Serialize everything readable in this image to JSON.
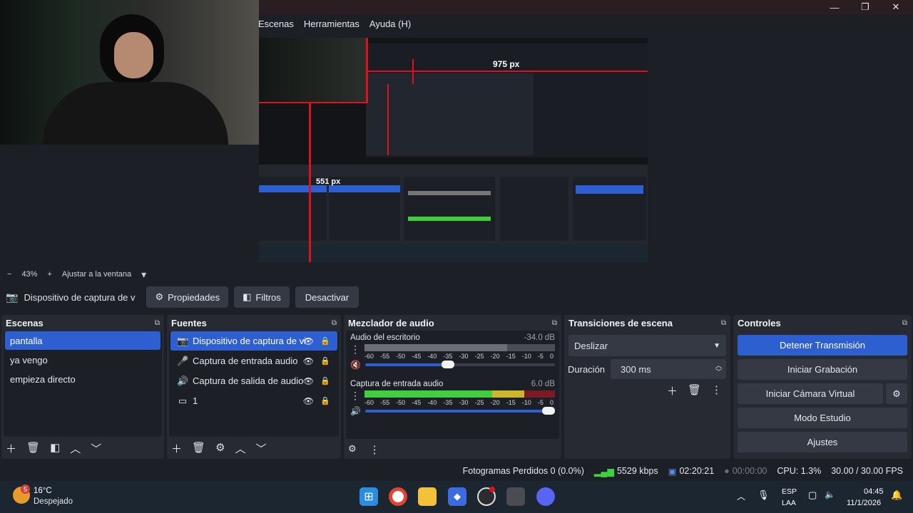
{
  "window": {
    "minimize": "—",
    "maximize": "❐",
    "close": "✕"
  },
  "menu": {
    "items": [
      "Escenas",
      "Herramientas",
      "Ayuda (H)"
    ]
  },
  "preview": {
    "annotation_width": "975 px",
    "annotation_height": "551 px"
  },
  "zoom": {
    "minus": "−",
    "percent": "43%",
    "plus": "+",
    "fit_label": "Ajustar a la ventana",
    "dropdown": "▾"
  },
  "context": {
    "source_name": "Dispositivo de captura de v",
    "properties": "Propiedades",
    "filters": "Filtros",
    "deactivate": "Desactivar"
  },
  "scenes": {
    "title": "Escenas",
    "items": [
      "pantalla",
      "ya vengo",
      "empieza directo"
    ],
    "selected_index": 0
  },
  "sources": {
    "title": "Fuentes",
    "items": [
      {
        "label": "Dispositivo de captura de vi",
        "icon": "camera-icon"
      },
      {
        "label": "Captura de entrada audio",
        "icon": "microphone-icon"
      },
      {
        "label": "Captura de salida de audio",
        "icon": "speaker-icon"
      },
      {
        "label": "1",
        "icon": "monitor-icon"
      }
    ]
  },
  "mixer": {
    "title": "Mezclador de audio",
    "channels": [
      {
        "name": "Audio del escritorio",
        "db": "-34.0 dB",
        "volume": 0.47,
        "muted": true
      },
      {
        "name": "Captura de entrada audio",
        "db": "6.0 dB",
        "volume": 1.0,
        "muted": false
      }
    ],
    "ticks": [
      "-60",
      "-55",
      "-50",
      "-45",
      "-40",
      "-35",
      "-30",
      "-25",
      "-20",
      "-15",
      "-10",
      "-5",
      "0"
    ]
  },
  "transitions": {
    "title": "Transiciones de escena",
    "selected": "Deslizar",
    "duration_label": "Duración",
    "duration_value": "300 ms"
  },
  "controls": {
    "title": "Controles",
    "stop_stream": "Detener Transmisión",
    "start_recording": "Iniciar Grabación",
    "virtual_cam": "Iniciar Cámara Virtual",
    "studio_mode": "Modo Estudio",
    "settings": "Ajustes"
  },
  "status": {
    "dropped_frames": "Fotogramas Perdidos 0 (0.0%)",
    "bitrate": "5529 kbps",
    "stream_time": "02:20:21",
    "rec_time": "00:00:00",
    "cpu": "CPU: 1.3%",
    "fps": "30.00 / 30.00 FPS"
  },
  "taskbar": {
    "temp": "16°C",
    "weather": "Despejado",
    "weather_badge": "5",
    "lang_top": "ESP",
    "lang_bottom": "LAA",
    "time": "04:45",
    "date": "11/1/2026"
  },
  "colors": {
    "accent": "#2d5fd0",
    "meter_green": "#3fcf3f",
    "meter_yellow": "#c9b92a",
    "meter_red": "#7a1a24",
    "annotation_red": "#e0101c"
  }
}
